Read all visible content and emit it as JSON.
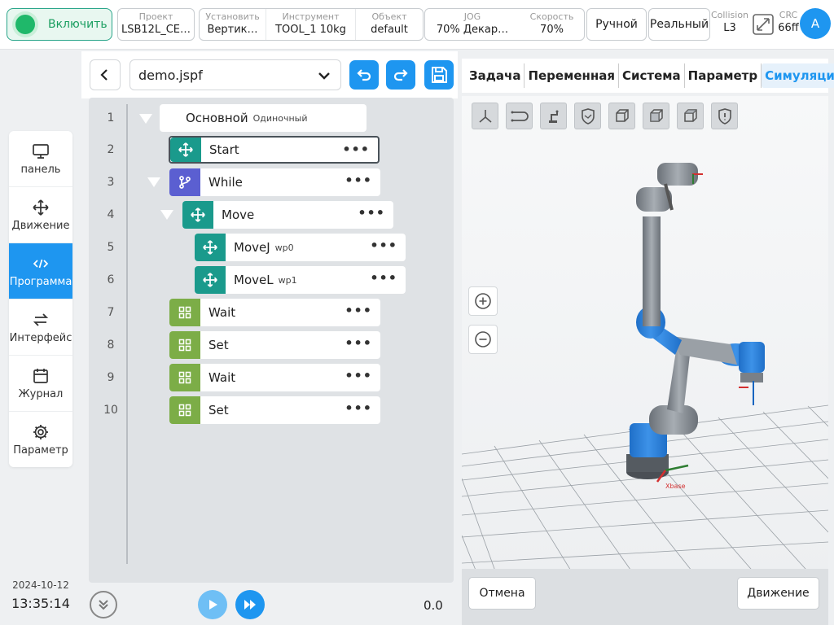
{
  "topbar": {
    "power_label": "Включить",
    "project": {
      "caption": "Проект",
      "value": "LSB12L_CE…"
    },
    "install": {
      "caption": "Установить",
      "value": "Вертик…"
    },
    "tool": {
      "caption": "Инструмент",
      "value": "TOOL_1  10kg"
    },
    "object": {
      "caption": "Объект",
      "value": "default"
    },
    "jog": {
      "caption": "JOG",
      "value": "70%  Декар…"
    },
    "speed": {
      "caption": "Скорость",
      "value": "70%"
    },
    "mode_button": "Ручной",
    "real_button": "Реальный",
    "collision": {
      "caption": "Collision",
      "value": "L3"
    },
    "crc": {
      "caption": "CRC",
      "value": "66ff"
    },
    "avatar_letter": "A",
    "colors": {
      "accent": "#1e96f0",
      "power_green": "#1fb86a"
    }
  },
  "sidebar": {
    "items": [
      {
        "label": "панель",
        "icon": "monitor-icon"
      },
      {
        "label": "Движение",
        "icon": "move-icon"
      },
      {
        "label": "Программа",
        "icon": "code-icon",
        "active": true
      },
      {
        "label": "Интерфейс",
        "icon": "swap-icon"
      },
      {
        "label": "Журнал",
        "icon": "calendar-icon"
      },
      {
        "label": "Параметр",
        "icon": "gear-icon"
      }
    ],
    "date": "2024-10-12",
    "time": "13:35:14"
  },
  "program": {
    "file_name": "demo.jspf",
    "root": {
      "name": "Основной",
      "sub": "Одиночный"
    },
    "lines": [
      {
        "no": "1"
      },
      {
        "no": "2",
        "name": "Start",
        "sub": ""
      },
      {
        "no": "3",
        "name": "While",
        "sub": ""
      },
      {
        "no": "4",
        "name": "Move",
        "sub": ""
      },
      {
        "no": "5",
        "name": "MoveJ",
        "sub": "wp0"
      },
      {
        "no": "6",
        "name": "MoveL",
        "sub": "wp1"
      },
      {
        "no": "7",
        "name": "Wait",
        "sub": ""
      },
      {
        "no": "8",
        "name": "Set",
        "sub": ""
      },
      {
        "no": "9",
        "name": "Wait",
        "sub": ""
      },
      {
        "no": "10",
        "name": "Set",
        "sub": ""
      }
    ],
    "more_label": "•••",
    "speed_value": "0.0"
  },
  "right_panel": {
    "tabs": [
      "Задача",
      "Переменная",
      "Система",
      "Параметр",
      "Симуляция"
    ],
    "active_tab": "Симуляция",
    "cancel_button": "Отмена",
    "move_button": "Движение",
    "axis_label": "Xbase"
  }
}
